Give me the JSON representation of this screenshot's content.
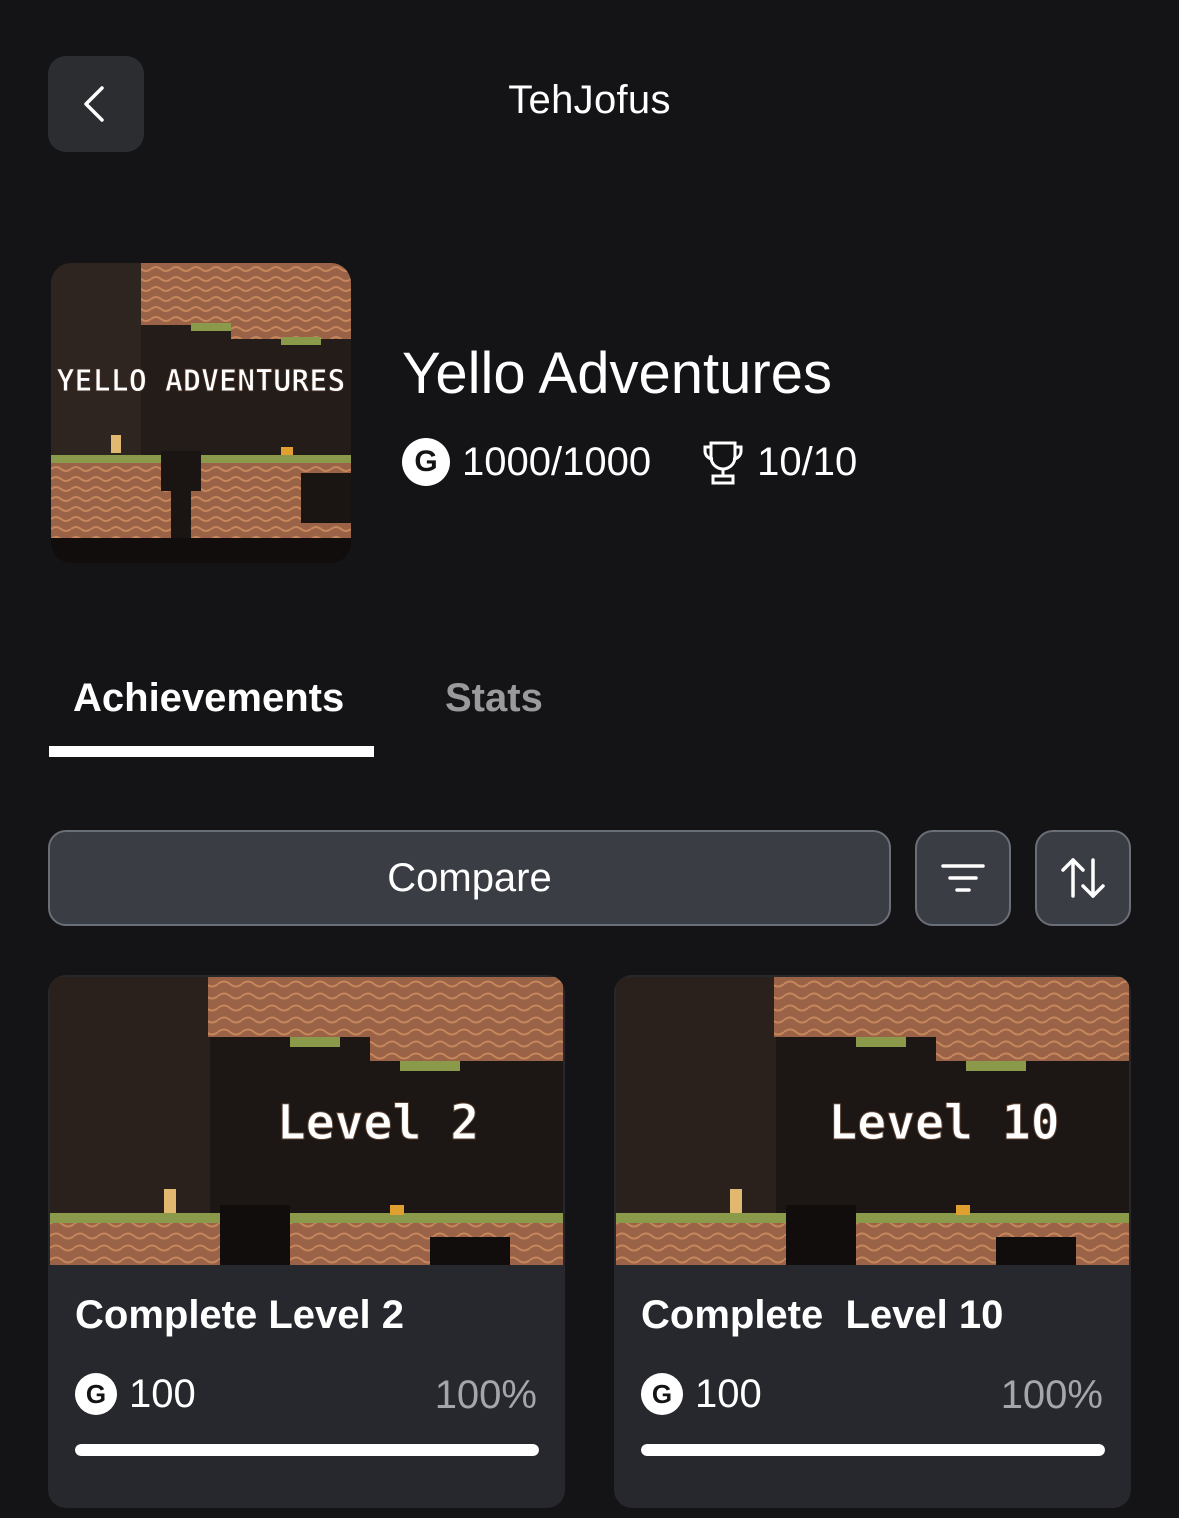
{
  "header": {
    "title": "TehJofus",
    "back_icon": "chevron-left-icon"
  },
  "game": {
    "title": "Yello Adventures",
    "art_text": "YELLO ADVENTURES",
    "gamerscore": "1000/1000",
    "achievements": "10/10",
    "gamerscore_icon": "G"
  },
  "tabs": [
    {
      "label": "Achievements",
      "active": true
    },
    {
      "label": "Stats",
      "active": false
    }
  ],
  "toolbar": {
    "compare_label": "Compare",
    "filter_icon": "filter-icon",
    "sort_icon": "sort-icon"
  },
  "cards": [
    {
      "art_label": "Level 2",
      "title": "Complete Level 2",
      "score": "100",
      "percent": "100%",
      "progress": 1.0
    },
    {
      "art_label": "Level 10",
      "title": "Complete  Level 10",
      "score": "100",
      "percent": "100%",
      "progress": 1.0
    }
  ],
  "colors": {
    "background": "#141416",
    "button": "#3a3d44",
    "card": "#26282d",
    "dirt": "#9a6247",
    "grass": "#8a9a4a"
  }
}
